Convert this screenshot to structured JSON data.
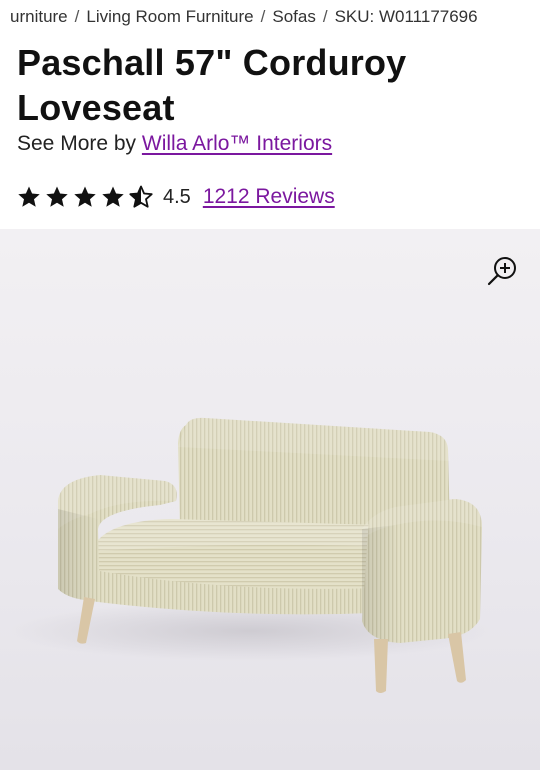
{
  "breadcrumb": {
    "items": [
      "urniture",
      "Living Room Furniture",
      "Sofas",
      "SKU: W011177696"
    ],
    "separator": "/"
  },
  "product": {
    "title": "Paschall 57\" Corduroy Loveseat",
    "see_more_prefix": "See More by",
    "brand": "Willa Arlo™ Interiors",
    "rating": "4.5",
    "rating_fraction": 0.9,
    "reviews_label": "1212 Reviews"
  },
  "image": {
    "zoom_icon": "zoom-in-icon",
    "subject": "loveseat"
  },
  "colors": {
    "link": "#7b189f",
    "star": "#111111",
    "upholstery": "#e2dfc7",
    "legs": "#d9c6a6"
  }
}
